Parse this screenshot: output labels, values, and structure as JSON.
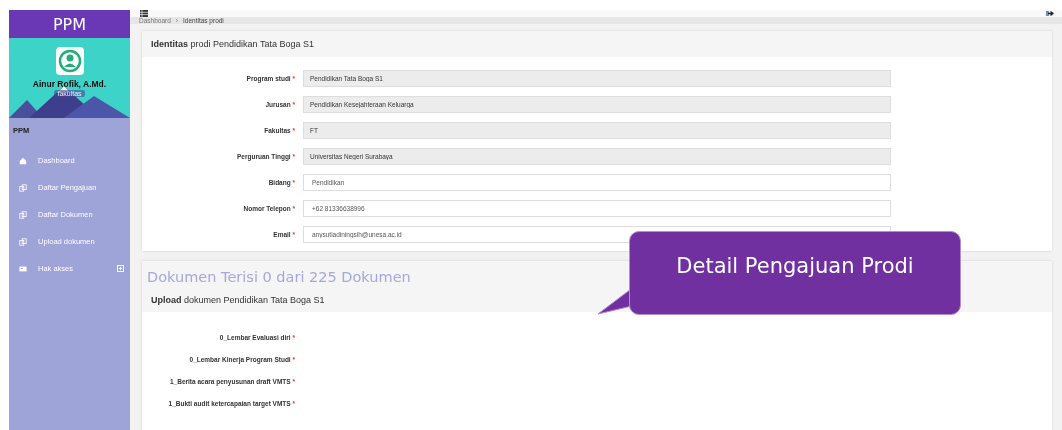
{
  "sidebar": {
    "brand": "PPM",
    "user": {
      "name": "Ainur Rofik, A.Md.",
      "role": "fakultas"
    },
    "section": "PPM",
    "items": [
      {
        "label": "Dashboard",
        "kind": "home",
        "expandable": false
      },
      {
        "label": "Daftar Pengajuan",
        "kind": "copy",
        "expandable": false
      },
      {
        "label": "Daftar Dokumen",
        "kind": "copy",
        "expandable": false
      },
      {
        "label": "Upload dokumen",
        "kind": "copy",
        "expandable": false
      },
      {
        "label": "Hak akses",
        "kind": "card",
        "expandable": true
      }
    ]
  },
  "breadcrumb": {
    "items": [
      "Dashboard",
      "Identitas prodi"
    ],
    "separator": "›"
  },
  "required_mark": "*",
  "identity_card": {
    "title": "**Identitas** prodi Pendidikan Tata Boga S1",
    "fields": [
      {
        "label": "Program studi",
        "value": "Pendidikan Tata Boga S1",
        "readonly": true
      },
      {
        "label": "Jurusan",
        "value": "Pendidikan Kesejahteraan Keluarga",
        "readonly": true
      },
      {
        "label": "Fakultas",
        "value": "FT",
        "readonly": true
      },
      {
        "label": "Perguruan Tinggi",
        "value": "Universitas Negeri Surabaya",
        "readonly": true
      },
      {
        "label": "Bidang",
        "value": "Pendidikan",
        "readonly": false
      },
      {
        "label": "Nomor Telepon",
        "value": "+62 81336638996",
        "readonly": false
      },
      {
        "label": "Email",
        "value": "anysutiadiningsih@unesa.ac.id",
        "readonly": false
      }
    ]
  },
  "documents_card": {
    "heading": "Dokumen Terisi 0 dari 225 Dokumen",
    "title": "**Upload** dokumen Pendidikan Tata Boga S1",
    "documents": [
      "0_Lembar Evaluasi diri",
      "0_Lembar Kinerja Program Studi",
      "1_Berita acara penyusunan draft VMTS",
      "1_Bukti audit ketercapaian target VMTS"
    ]
  },
  "callout": "Detail Pengajuan Prodi"
}
